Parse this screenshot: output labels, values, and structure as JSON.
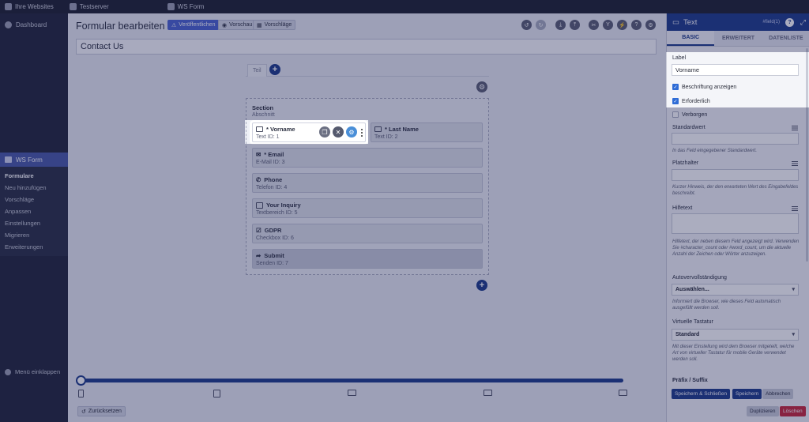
{
  "adminbar": {
    "items": [
      {
        "label": "Ihre Websites"
      },
      {
        "label": "Testserver"
      },
      {
        "label": "WS Form"
      }
    ]
  },
  "sidebar": {
    "dashboard": "Dashboard",
    "plugin": "WS Form",
    "items": [
      "Formulare",
      "Neu hinzufügen",
      "Vorschläge",
      "Anpassen",
      "Einstellungen",
      "Migrieren",
      "Erweiterungen"
    ],
    "collapse": "Menü einklappen"
  },
  "main": {
    "title": "Formular bearbeiten",
    "buttons": {
      "publish": "Veröffentlichen",
      "preview": "Vorschau",
      "suggestions": "Vorschläge"
    },
    "form_name": "Contact Us",
    "tab": "Teil",
    "section": {
      "title": "Section",
      "subtitle": "Abschnitt"
    },
    "fields": [
      {
        "label": "* Vorname",
        "type": "Text",
        "id": "ID: 1",
        "icon": "text-field-icon"
      },
      {
        "label": "* Last Name",
        "type": "Text",
        "id": "ID: 2",
        "icon": "text-field-icon"
      },
      {
        "label": "* Email",
        "type": "E-Mail",
        "id": "ID: 3",
        "icon": "envelope-icon"
      },
      {
        "label": "Phone",
        "type": "Telefon",
        "id": "ID: 4",
        "icon": "phone-icon"
      },
      {
        "label": "Your Inquiry",
        "type": "Textbereich",
        "id": "ID: 5",
        "icon": "textarea-icon"
      },
      {
        "label": "GDPR",
        "type": "Checkbox",
        "id": "ID: 6",
        "icon": "checkbox-icon"
      },
      {
        "label": "Submit",
        "type": "Senden",
        "id": "ID: 7",
        "icon": "submit-arrow-icon"
      }
    ],
    "reset": "Zurücksetzen"
  },
  "panel": {
    "title": "Text",
    "meta": "#field(1)",
    "tabs": [
      "BASIC",
      "ERWEITERT",
      "DATENLISTE"
    ],
    "label_title": "Label",
    "label_value": "Vorname",
    "checkboxes": [
      {
        "label": "Beschriftung anzeigen",
        "checked": true
      },
      {
        "label": "Erforderlich",
        "checked": true
      },
      {
        "label": "Verborgen",
        "checked": false
      }
    ],
    "default_title": "Standardwert",
    "default_hint": "In das Feld eingegebener Standardwert.",
    "placeholder_title": "Platzhalter",
    "placeholder_hint": "Kurzer Hinweis, der den erwarteten Wert des Eingabefeldes beschreibt.",
    "help_title": "Hilfetext",
    "help_hint": "Hilfetext, der neben diesem Feld angezeigt wird. Verwenden Sie #character_count oder #word_count, um die aktuelle Anzahl der Zeichen oder Wörter anzuzeigen.",
    "autocomplete_title": "Autovervollständigung",
    "autocomplete_value": "Auswählen...",
    "autocomplete_hint": "Informiert die Browser, wie dieses Feld automatisch ausgefüllt werden soll.",
    "keyboard_title": "Virtuelle Tastatur",
    "keyboard_value": "Standard",
    "keyboard_hint": "Mit dieser Einstellung wird dem Browser mitgeteilt, welche Art von virtueller Tastatur für mobile Geräte verwendet werden soll.",
    "prefix_title": "Präfix / Suffix",
    "buttons": {
      "save_close": "Speichern & Schließen",
      "save": "Speichern",
      "cancel": "Abbrechen",
      "duplicate": "Duplizieren",
      "delete": "Löschen"
    }
  },
  "colors": {
    "accent": "#1f3c8a",
    "danger": "#c8283a",
    "overlay": "#161c4e"
  }
}
